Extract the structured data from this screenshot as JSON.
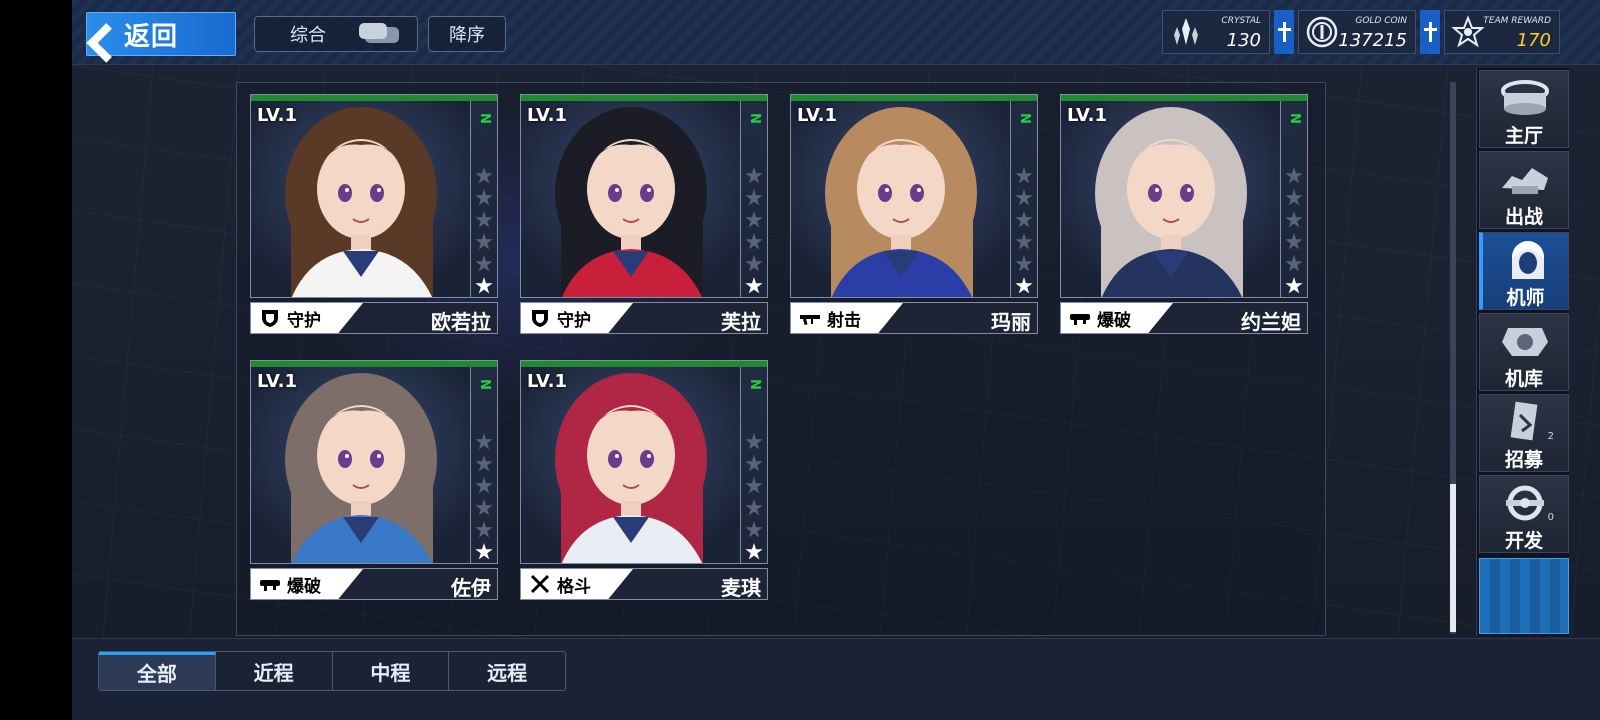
{
  "header": {
    "back_label": "返回",
    "sort_label": "综合",
    "order_label": "降序",
    "resources": [
      {
        "label": "CRYSTAL",
        "value": "130",
        "icon": "crystal-icon"
      },
      {
        "label": "GOLD COIN",
        "value": "137215",
        "icon": "gold-coin-icon"
      },
      {
        "label": "TEAM REWARD",
        "value": "170",
        "icon": "team-reward-icon",
        "color": "#ffcc33"
      }
    ]
  },
  "pilots": [
    {
      "level": "LV.1",
      "rank": "N",
      "stars": 1,
      "role": "守护",
      "role_icon": "shield-icon",
      "name": "欧若拉",
      "hair": "#5a3a26",
      "accent": "#f4f4f4"
    },
    {
      "level": "LV.1",
      "rank": "N",
      "stars": 1,
      "role": "守护",
      "role_icon": "shield-icon",
      "name": "芙拉",
      "hair": "#1c1c26",
      "accent": "#c8203a"
    },
    {
      "level": "LV.1",
      "rank": "N",
      "stars": 1,
      "role": "射击",
      "role_icon": "rifle-icon",
      "name": "玛丽",
      "hair": "#b88a60",
      "accent": "#2b3ea8"
    },
    {
      "level": "LV.1",
      "rank": "N",
      "stars": 1,
      "role": "爆破",
      "role_icon": "launcher-icon",
      "name": "约兰妲",
      "hair": "#c9c2c0",
      "accent": "#24345e"
    },
    {
      "level": "LV.1",
      "rank": "N",
      "stars": 1,
      "role": "爆破",
      "role_icon": "launcher-icon",
      "name": "佐伊",
      "hair": "#7d6e6a",
      "accent": "#3a78c8"
    },
    {
      "level": "LV.1",
      "rank": "N",
      "stars": 1,
      "role": "格斗",
      "role_icon": "swords-icon",
      "name": "麦琪",
      "hair": "#b02645",
      "accent": "#e8eef4"
    }
  ],
  "nav": [
    {
      "label": "主厅",
      "icon": "hall-icon"
    },
    {
      "label": "出战",
      "icon": "sortie-icon"
    },
    {
      "label": "机师",
      "icon": "pilot-icon",
      "active": true
    },
    {
      "label": "机库",
      "icon": "hangar-icon"
    },
    {
      "label": "招募",
      "icon": "recruit-icon",
      "badge": "2"
    },
    {
      "label": "开发",
      "icon": "develop-icon",
      "badge": "0"
    }
  ],
  "tabs": [
    {
      "label": "全部",
      "active": true
    },
    {
      "label": "近程"
    },
    {
      "label": "中程"
    },
    {
      "label": "远程"
    }
  ]
}
